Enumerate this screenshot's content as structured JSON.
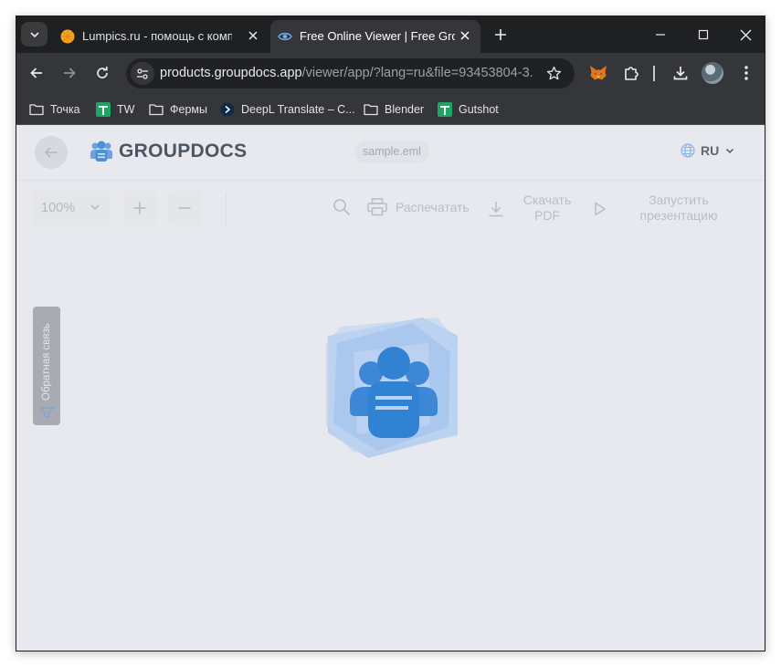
{
  "browser": {
    "tabs": [
      {
        "title": "Lumpics.ru - помощь с компьют",
        "favicon": "orange-circle-icon",
        "active": false
      },
      {
        "title": "Free Online Viewer | Free Group",
        "favicon": "eye-icon",
        "active": true
      }
    ],
    "omnibox": {
      "host": "products.groupdocs.app",
      "path": "/viewer/app/?lang=ru&file=93453804-3..."
    },
    "bookmarks": [
      {
        "label": "Точка",
        "icon": "folder-icon"
      },
      {
        "label": "TW",
        "icon": "sheets-icon"
      },
      {
        "label": "Фермы",
        "icon": "folder-icon"
      },
      {
        "label": "DeepL Translate – C...",
        "icon": "deepl-icon"
      },
      {
        "label": "Blender",
        "icon": "folder-icon"
      },
      {
        "label": "Gutshot",
        "icon": "sheets-icon"
      }
    ]
  },
  "app": {
    "logo_text": "GROUPDOCS",
    "file_name": "sample.eml",
    "language": "RU",
    "toolbar": {
      "zoom": "100%",
      "print_label": "Распечатать",
      "download_label": "Скачать PDF",
      "download_line1": "Скачать",
      "download_line2": "PDF",
      "presentation_label": "Запустить презентацию",
      "presentation_line1": "Запустить",
      "presentation_line2": "презентацию"
    },
    "feedback_label": "Обратная связь"
  },
  "colors": {
    "brand": "#4a8fd9",
    "tabstrip": "#1f2021",
    "toolbar": "#35363a",
    "page_bg": "#e8e9ee"
  }
}
